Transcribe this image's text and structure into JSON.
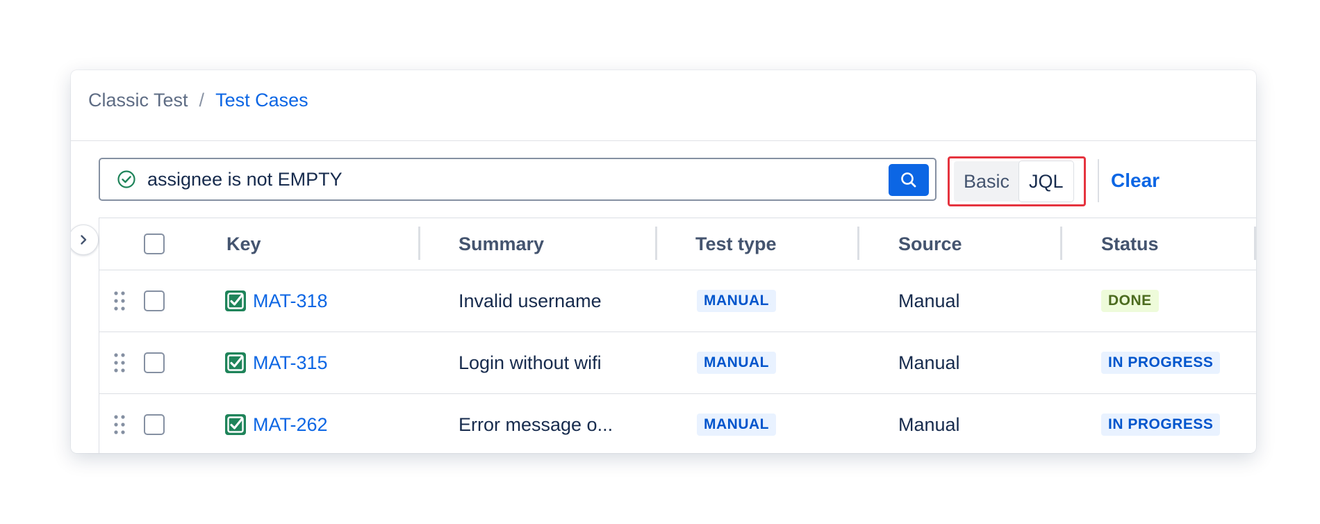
{
  "breadcrumb": {
    "parent": "Classic Test",
    "separator": "/",
    "current": "Test Cases"
  },
  "search": {
    "query": "assignee is not EMPTY",
    "valid_icon": "check-circle-icon",
    "button_icon": "search-icon"
  },
  "mode": {
    "basic": "Basic",
    "jql": "JQL",
    "active": "JQL"
  },
  "actions": {
    "clear": "Clear"
  },
  "table": {
    "columns": {
      "key": "Key",
      "summary": "Summary",
      "test_type": "Test type",
      "source": "Source",
      "status": "Status"
    },
    "rows": [
      {
        "key": "MAT-318",
        "summary": "Invalid username",
        "test_type": "MANUAL",
        "source": "Manual",
        "status": "DONE"
      },
      {
        "key": "MAT-315",
        "summary": "Login without wifi",
        "test_type": "MANUAL",
        "source": "Manual",
        "status": "IN PROGRESS"
      },
      {
        "key": "MAT-262",
        "summary": "Error message o...",
        "test_type": "MANUAL",
        "source": "Manual",
        "status": "IN PROGRESS"
      }
    ]
  },
  "colors": {
    "link": "#0c66e4",
    "highlight_border": "#e5343f",
    "test_icon": "#1f845a",
    "done_bg": "#eefbda",
    "progress_bg": "#e9f2ff"
  }
}
